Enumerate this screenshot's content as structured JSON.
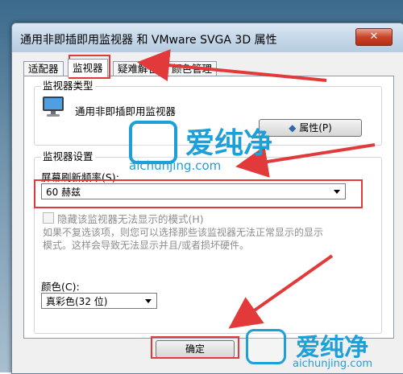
{
  "window": {
    "title": "通用非即插即用监视器 和 VMware SVGA 3D 属性",
    "close_label": "✕"
  },
  "tabs": [
    {
      "label": "适配器"
    },
    {
      "label": "监视器"
    },
    {
      "label": "疑难解答"
    },
    {
      "label": "颜色管理"
    }
  ],
  "monitor_type": {
    "group_label": "监视器类型",
    "name": "通用非即插即用监视器",
    "properties_button": "属性(P)"
  },
  "monitor_settings": {
    "group_label": "监视器设置",
    "refresh_label": "屏幕刷新频率(S):",
    "refresh_value": "60 赫兹",
    "hide_modes_label": "隐藏该监视器无法显示的模式(H)",
    "hide_modes_checked": false,
    "description": [
      "如果不复选该项，则您可以选择那些该监视器无法正常显示的显示",
      "模式。这样会导致无法显示并且/或者损坏硬件。"
    ]
  },
  "colors": {
    "label": "颜色(C):",
    "value": "真彩色(32 位)"
  },
  "footer": {
    "ok_button": "确定"
  },
  "watermark": {
    "brand": "爱纯净",
    "url": "aichunjing.com"
  },
  "annotation_color": "#e23a3a",
  "watermark_color": "#1d9fd8"
}
